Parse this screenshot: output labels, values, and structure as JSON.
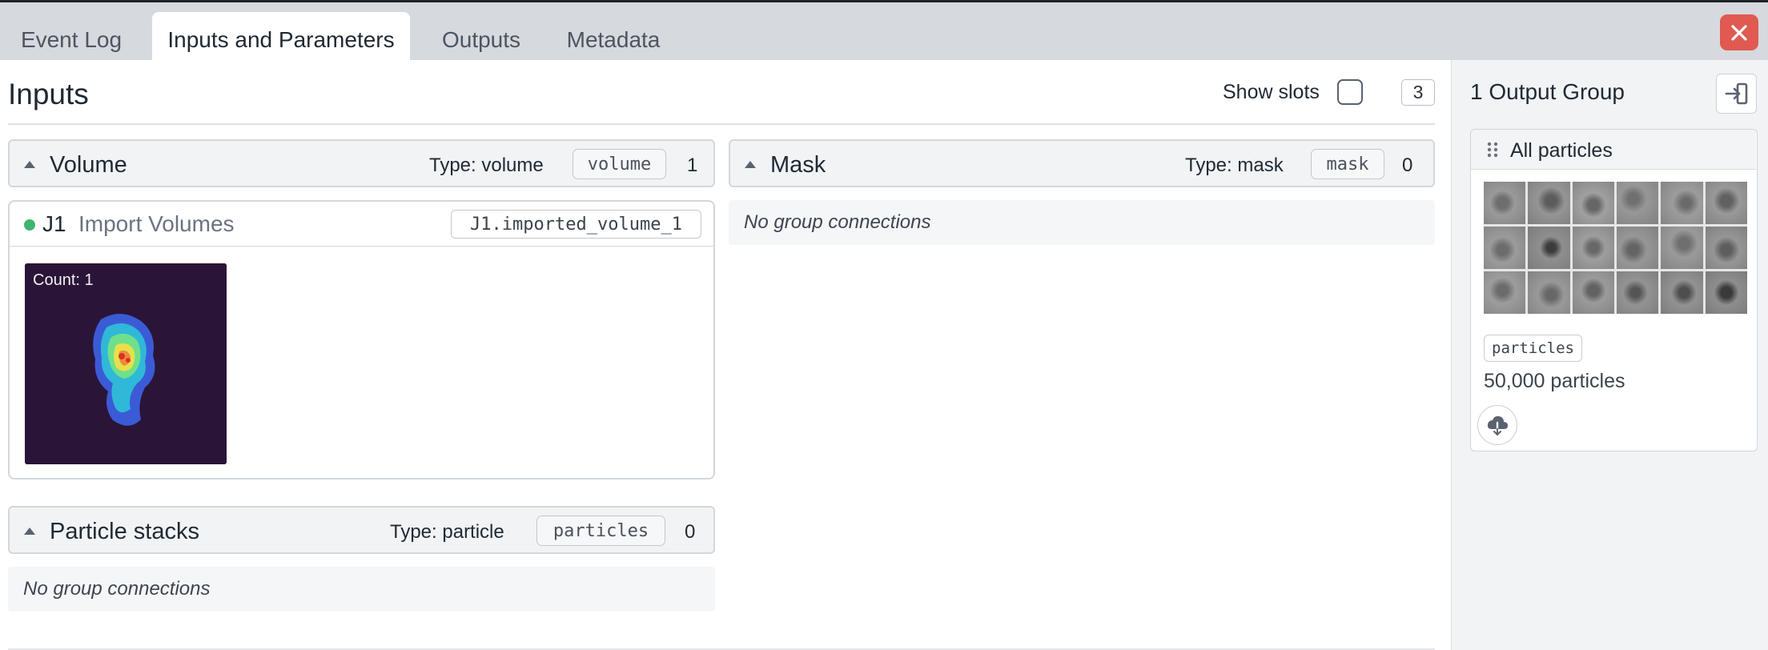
{
  "tabs": [
    "Event Log",
    "Inputs and Parameters",
    "Outputs",
    "Metadata"
  ],
  "active_tab": "Inputs and Parameters",
  "inputs": {
    "title": "Inputs",
    "show_slots_label": "Show slots",
    "show_slots_checked": false,
    "count": "3"
  },
  "sections": {
    "volume": {
      "name": "Volume",
      "type": "Type: volume",
      "code": "volume",
      "count": "1"
    },
    "mask": {
      "name": "Mask",
      "type": "Type: mask",
      "code": "mask",
      "count": "0",
      "empty": "No group connections"
    },
    "particles": {
      "name": "Particle stacks",
      "type": "Type: particle",
      "code": "particles",
      "count": "0",
      "empty": "No group connections"
    }
  },
  "connection": {
    "job_id": "J1",
    "job_name": "Import Volumes",
    "output": "J1.imported_volume_1",
    "thumb_count": "Count: 1"
  },
  "output_panel": {
    "title": "1 Output Group",
    "group_name": "All particles",
    "tag": "particles",
    "count_text": "50,000 particles"
  },
  "colors": {
    "close_button": "#e05a52",
    "status_dot": "#3fb56f",
    "tab_bar": "#d6d9de"
  }
}
